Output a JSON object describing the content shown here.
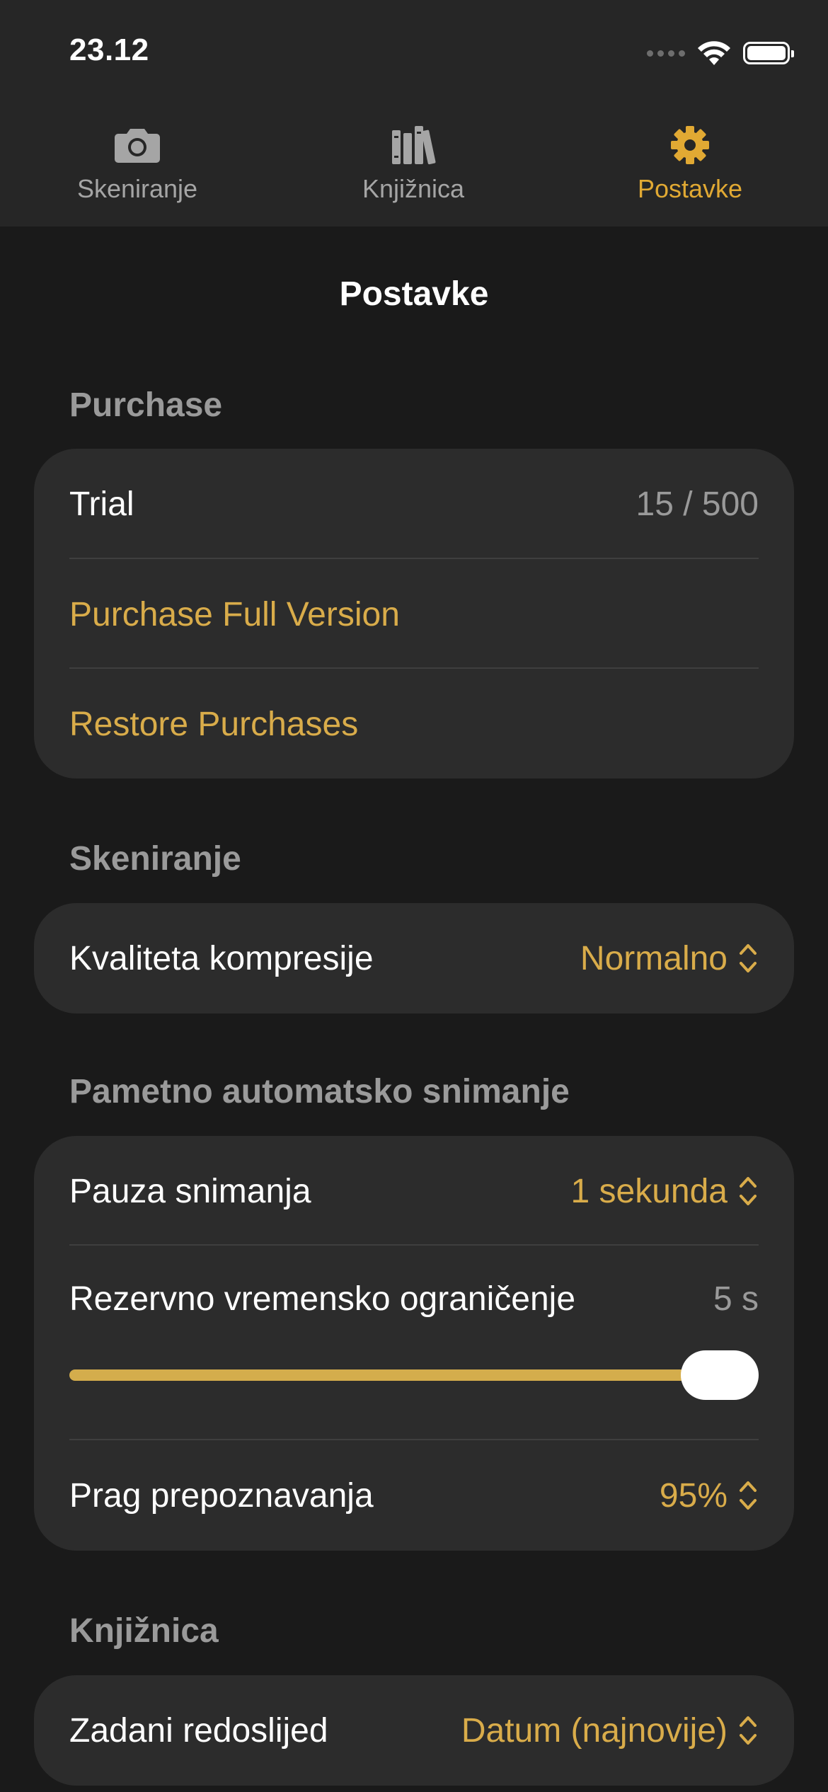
{
  "status_bar": {
    "time": "23.12"
  },
  "tabs": [
    {
      "label": "Skeniranje",
      "icon": "camera-icon",
      "active": false
    },
    {
      "label": "Knjižnica",
      "icon": "books-icon",
      "active": false
    },
    {
      "label": "Postavke",
      "icon": "gear-icon",
      "active": true
    }
  ],
  "page_title": "Postavke",
  "colors": {
    "accent": "#E1A933",
    "background": "#1A1A1A",
    "group_background": "#2C2C2C",
    "secondary_text": "#9A9A9A"
  },
  "sections": {
    "purchase": {
      "header": "Purchase",
      "trial_label": "Trial",
      "trial_value": "15 / 500",
      "purchase_full": "Purchase Full Version",
      "restore": "Restore Purchases"
    },
    "scanning": {
      "header": "Skeniranje",
      "compression_label": "Kvaliteta kompresije",
      "compression_value": "Normalno"
    },
    "auto_capture": {
      "header": "Pametno automatsko snimanje",
      "pause_label": "Pauza snimanja",
      "pause_value": "1 sekunda",
      "timeout_label": "Rezervno vremensko ograničenje",
      "timeout_value": "5 s",
      "timeout_slider_fraction": 1.0,
      "threshold_label": "Prag prepoznavanja",
      "threshold_value": "95%"
    },
    "library": {
      "header": "Knjižnica",
      "sort_label": "Zadani redoslijed",
      "sort_value": "Datum (najnovije)"
    }
  }
}
